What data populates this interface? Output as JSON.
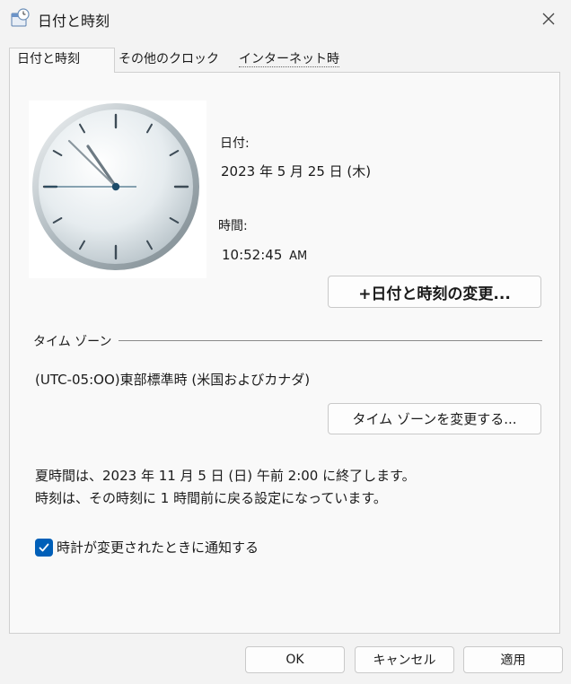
{
  "window": {
    "title": "日付と時刻"
  },
  "tabs": [
    {
      "label": "日付と時刻"
    },
    {
      "label": "その他のクロック"
    },
    {
      "label": "インターネット時間"
    }
  ],
  "datetime": {
    "date_label": "日付:",
    "date_value": "2023 年 5 月 25 日 (木)",
    "time_label": "時間:",
    "time_value": "10:52:45",
    "time_ampm": "AM",
    "change_button": "+日付と時刻の変更..."
  },
  "timezone": {
    "section_label": "タイム ゾーン",
    "value": "(UTC-05:OO)東部標準時 (米国およびカナダ)",
    "change_button": "タイム ゾーンを変更する..."
  },
  "dst": {
    "line1": "夏時間は、2023 年 11 月 5 日 (日) 午前 2:00 に終了します。",
    "line2": "時刻は、その時刻に 1 時間前に戻る設定になっています。"
  },
  "notify": {
    "label": "時計が変更されたときに通知する",
    "checked": true
  },
  "footer": {
    "ok": "OK",
    "cancel": "キャンセル",
    "apply": "適用"
  },
  "icons": [
    "clock-app-icon",
    "close-icon",
    "analog-clock-icon",
    "checkmark-icon"
  ],
  "colors": {
    "accent": "#005fb8",
    "background": "#f3f3f3",
    "panel": "#f9f9f9"
  }
}
